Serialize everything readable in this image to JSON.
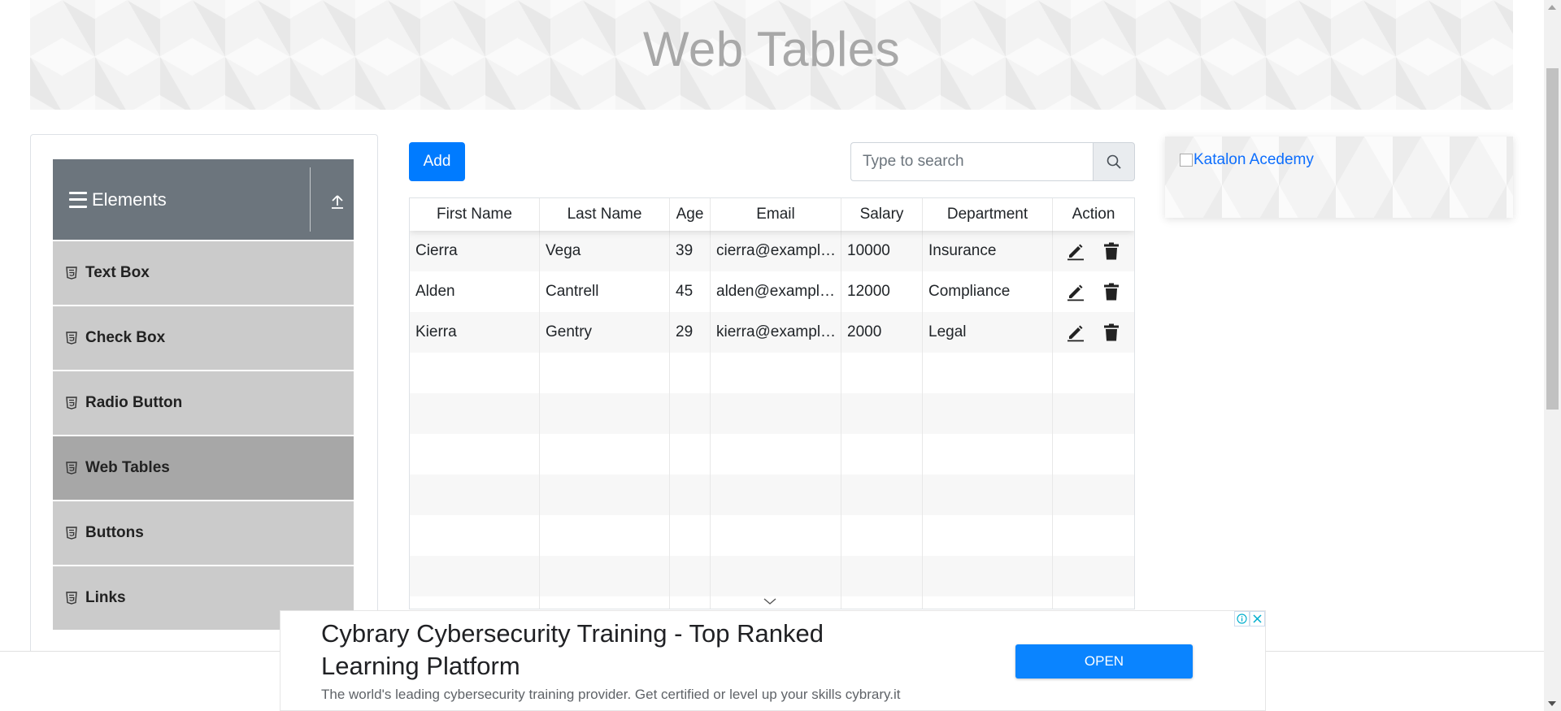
{
  "banner": {
    "title": "Web Tables"
  },
  "sidebar": {
    "group_title": "Elements",
    "items": [
      {
        "label": "Text Box",
        "active": false
      },
      {
        "label": "Check Box",
        "active": false
      },
      {
        "label": "Radio Button",
        "active": false
      },
      {
        "label": "Web Tables",
        "active": true
      },
      {
        "label": "Buttons",
        "active": false
      },
      {
        "label": "Links",
        "active": false
      }
    ]
  },
  "toolbar": {
    "add_label": "Add",
    "search_placeholder": "Type to search",
    "search_value": ""
  },
  "table": {
    "headers": [
      "First Name",
      "Last Name",
      "Age",
      "Email",
      "Salary",
      "Department",
      "Action"
    ],
    "rows": [
      {
        "first_name": "Cierra",
        "last_name": "Vega",
        "age": "39",
        "email": "cierra@example.com",
        "salary": "10000",
        "department": "Insurance"
      },
      {
        "first_name": "Alden",
        "last_name": "Cantrell",
        "age": "45",
        "email": "alden@example.com",
        "salary": "12000",
        "department": "Compliance"
      },
      {
        "first_name": "Kierra",
        "last_name": "Gentry",
        "age": "29",
        "email": "kierra@example.com",
        "salary": "2000",
        "department": "Legal"
      }
    ],
    "empty_rows": 7
  },
  "side_ad": {
    "alt_text": "Katalon Acedemy"
  },
  "bottom_ad": {
    "headline": "Cybrary Cybersecurity Training - Top Ranked Learning Platform",
    "description": "The world's leading cybersecurity training provider. Get certified or level up your skills cybrary.it",
    "button_label": "OPEN"
  },
  "colors": {
    "primary": "#007bff",
    "sidebar_header": "#6c757d",
    "sidebar_item": "#cbcbcb",
    "sidebar_item_active": "#a7a7a7"
  },
  "icons": [
    "menu-icon",
    "collapse-up-icon",
    "html5-icon",
    "search-icon",
    "edit-pencil-icon",
    "trash-icon",
    "chevron-down-icon",
    "ad-info-icon",
    "ad-close-icon"
  ]
}
